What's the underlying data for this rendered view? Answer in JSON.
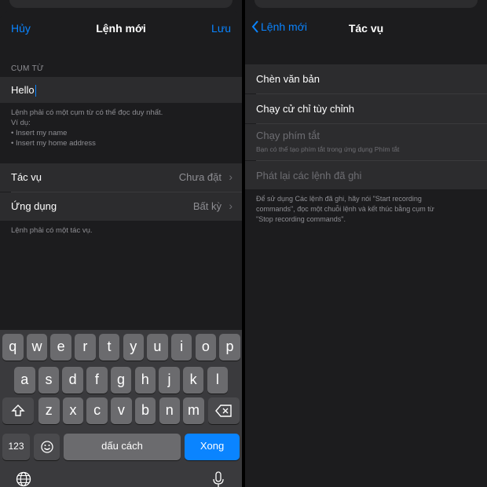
{
  "left": {
    "nav": {
      "cancel": "Hủy",
      "title": "Lệnh mới",
      "save": "Lưu"
    },
    "phrase_section": {
      "header": "CỤM TỪ",
      "value": "Hello",
      "note_lines": [
        "Lệnh phải có một cụm từ có thể đọc duy nhất.",
        "Ví dụ:",
        "• Insert my name",
        "• Insert my home address"
      ]
    },
    "rows": [
      {
        "label": "Tác vụ",
        "value": "Chưa đặt"
      },
      {
        "label": "Ứng dụng",
        "value": "Bất kỳ"
      }
    ],
    "rows_note": "Lệnh phải có một tác vụ.",
    "keyboard": {
      "row1": [
        "q",
        "w",
        "e",
        "r",
        "t",
        "y",
        "u",
        "i",
        "o",
        "p"
      ],
      "row2": [
        "a",
        "s",
        "d",
        "f",
        "g",
        "h",
        "j",
        "k",
        "l"
      ],
      "row3": [
        "z",
        "x",
        "c",
        "v",
        "b",
        "n",
        "m"
      ],
      "numbers": "123",
      "space": "dấu cách",
      "go": "Xong"
    }
  },
  "right": {
    "nav": {
      "back": "Lệnh mới",
      "title": "Tác vụ"
    },
    "items": [
      {
        "label": "Chèn văn bản"
      },
      {
        "label": "Chạy cử chỉ tùy chỉnh"
      },
      {
        "label": "Chạy phím tắt",
        "sub": "Bạn có thể tạo phím tắt trong ứng dụng Phím tắt"
      },
      {
        "label": "Phát lại các lệnh đã ghi"
      }
    ],
    "footer_lines": [
      "Để sử dụng Các lệnh đã ghi, hãy nói \"Start recording",
      "commands\", đọc một chuỗi lệnh và kết thúc bằng cụm từ",
      "\"Stop recording commands\"."
    ]
  },
  "colors": {
    "accent": "#0a84ff",
    "background": "#1c1c1e",
    "cell": "#2c2c2e",
    "secondary_text": "#8e8e93"
  },
  "icons": [
    "chevron-right-icon",
    "chevron-left-icon",
    "shift-icon",
    "backspace-icon",
    "emoji-icon",
    "globe-icon",
    "microphone-icon"
  ]
}
